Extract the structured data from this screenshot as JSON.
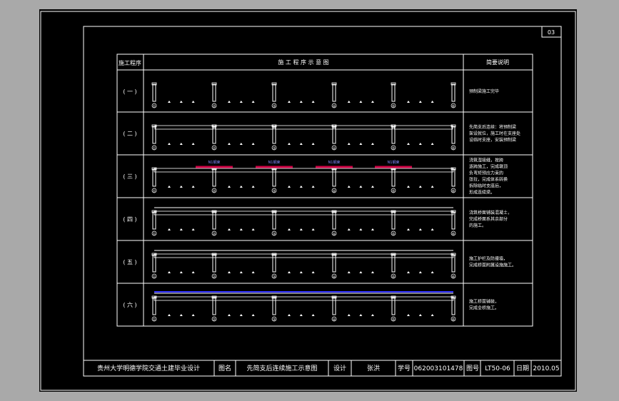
{
  "sheet_no": "03",
  "table": {
    "header": {
      "col1": "施工程序",
      "col2": "施 工 程 序 示 意 图",
      "col3": "简要说明"
    },
    "rows": [
      {
        "step": "( 一 )",
        "note": [
          "预制梁施工完毕"
        ]
      },
      {
        "step": "( 二 )",
        "note": [
          "先简支后连续：将预制梁",
          "架设就位，施工时在支座处",
          "设临时支座，安装预制梁"
        ]
      },
      {
        "step": "( 三 )",
        "note": [
          "浇筑湿接缝，按跨",
          "逐跨施工，完成墩顶",
          "负弯矩预应力束的",
          "张拉，完成体系转换",
          "拆除临时支座后，",
          "形成连续梁。"
        ]
      },
      {
        "step": "( 四 )",
        "note": [
          "浇筑桥面铺装混凝土，",
          "完成桥面系其余部分",
          "的施工。"
        ]
      },
      {
        "step": "( 五 )",
        "note": [
          "施工护栏及防撞墙，",
          "完成桥面附属设施施工。"
        ]
      },
      {
        "step": "( 六 )",
        "note": [
          "施工桥面铺装，",
          "完成全桥施工。"
        ]
      }
    ],
    "piers": [
      "①",
      "②",
      "③",
      "④",
      "⑤",
      "⑥"
    ],
    "tendon_labels": [
      "N1钢束",
      "N1钢束",
      "N1钢束",
      "N1钢束"
    ]
  },
  "title_block": {
    "school": "贵州大学明德学院交通土建毕业设计",
    "drawing_name_label": "图名",
    "drawing_name": "先简支后连续施工示意图",
    "designer_label": "设计",
    "designer": "张洪",
    "student_id_label": "学号",
    "student_id": "062003101478",
    "drawing_no_label": "图号",
    "drawing_no": "LT50-06",
    "date_label": "日期",
    "date": "2010.05"
  },
  "colors": {
    "background": "#000000",
    "frame": "#ffffff",
    "outer_bg": "#a9a9a9",
    "tendon": "#cc0044",
    "deck": "#3333ff"
  }
}
